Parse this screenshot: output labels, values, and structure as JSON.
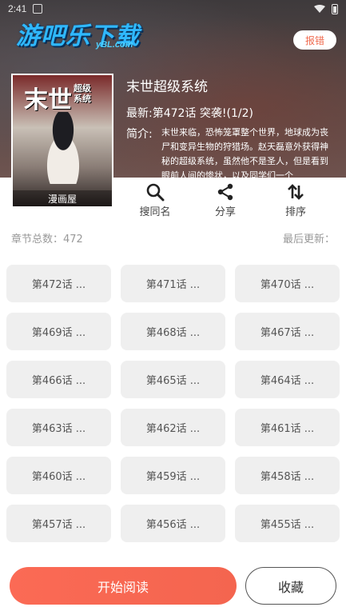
{
  "status_bar": {
    "time": "2:41"
  },
  "header": {
    "logo_text": "游吧乐下载",
    "logo_sub": "yBL.com",
    "report_label": "报错"
  },
  "book": {
    "cover_title": "末世",
    "cover_subtitle": "超级\n系统",
    "cover_tag": "漫画屋",
    "title": "末世超级系统",
    "latest_label": "最新:",
    "latest_value": "第472话 突袭!(1/2)",
    "intro_label": "简介:",
    "intro_text": "末世来临，恐怖笼罩整个世界，地球成为丧尸和变异生物的狩猎场。赵天磊意外获得神秘的超级系统，虽然他不是圣人，但是看到眼前人间的惨状，以及同学们一个"
  },
  "actions": [
    {
      "label": "搜同名",
      "icon": "search-icon"
    },
    {
      "label": "分享",
      "icon": "share-icon"
    },
    {
      "label": "排序",
      "icon": "sort-icon"
    }
  ],
  "stats": {
    "total_label": "章节总数：472",
    "updated_label": "最后更新："
  },
  "chapters": [
    "第472话 ...",
    "第471话 ...",
    "第470话 ...",
    "第469话 ...",
    "第468话 ...",
    "第467话 ...",
    "第466话 ...",
    "第465话 ...",
    "第464话 ...",
    "第463话 ...",
    "第462话 ...",
    "第461话 ...",
    "第460话 ...",
    "第459话 ...",
    "第458话 ...",
    "第457话 ...",
    "第456话 ...",
    "第455话 ...",
    "",
    "",
    ""
  ],
  "bottom": {
    "read_label": "开始阅读",
    "favorite_label": "收藏"
  },
  "colors": {
    "accent": "#f4654f",
    "chip_bg": "#efefef"
  }
}
